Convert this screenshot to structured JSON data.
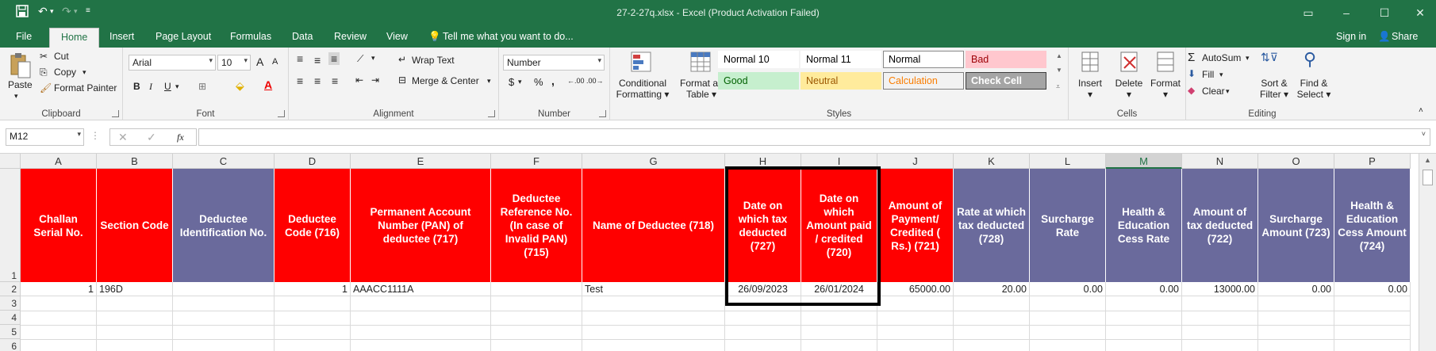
{
  "window": {
    "title": "27-2-27q.xlsx - Excel (Product Activation Failed)",
    "save_icon": "save-icon",
    "undo_icon": "undo-icon",
    "redo_icon": "redo-icon"
  },
  "tabs": [
    "File",
    "Home",
    "Insert",
    "Page Layout",
    "Formulas",
    "Data",
    "Review",
    "View"
  ],
  "tell_me": "Tell me what you want to do...",
  "sign_in": "Sign in",
  "share": "Share",
  "ribbon": {
    "clipboard": {
      "label": "Clipboard",
      "paste": "Paste",
      "cut": "Cut",
      "copy": "Copy",
      "format_painter": "Format Painter"
    },
    "font": {
      "label": "Font",
      "name": "Arial",
      "size": "10",
      "bold": "B",
      "italic": "I",
      "underline": "U",
      "grow": "A",
      "shrink": "A"
    },
    "alignment": {
      "label": "Alignment",
      "wrap": "Wrap Text",
      "merge": "Merge & Center"
    },
    "number": {
      "label": "Number",
      "format": "Number",
      "currency": "$",
      "percent": "%",
      "comma": ","
    },
    "styles": {
      "label": "Styles",
      "conditional": [
        "Conditional",
        "Formatting"
      ],
      "format_table": [
        "Format as",
        "Table"
      ],
      "cells": [
        {
          "text": "Normal 10",
          "bg": "#ffffff",
          "fg": "#000000",
          "border": "transparent"
        },
        {
          "text": "Normal 11",
          "bg": "#ffffff",
          "fg": "#000000",
          "border": "transparent"
        },
        {
          "text": "Normal",
          "bg": "#ffffff",
          "fg": "#000000",
          "border": "#8a8a8a"
        },
        {
          "text": "Bad",
          "bg": "#ffc7ce",
          "fg": "#9c0006",
          "border": "transparent"
        },
        {
          "text": "Good",
          "bg": "#c6efce",
          "fg": "#006100",
          "border": "transparent"
        },
        {
          "text": "Neutral",
          "bg": "#ffeb9c",
          "fg": "#9c5700",
          "border": "transparent"
        },
        {
          "text": "Calculation",
          "bg": "#f2f2f2",
          "fg": "#fa7d00",
          "border": "#7f7f7f"
        },
        {
          "text": "Check Cell",
          "bg": "#a5a5a5",
          "fg": "#ffffff",
          "border": "#3f3f3f"
        }
      ]
    },
    "cells": {
      "label": "Cells",
      "insert": "Insert",
      "delete": "Delete",
      "format": "Format"
    },
    "editing": {
      "label": "Editing",
      "autosum": "AutoSum",
      "fill": "Fill",
      "clear": "Clear",
      "sort": [
        "Sort &",
        "Filter"
      ],
      "find": [
        "Find &",
        "Select"
      ]
    }
  },
  "formula_bar": {
    "name_box": "M12",
    "fx": "fx",
    "formula": ""
  },
  "columns": [
    "A",
    "B",
    "C",
    "D",
    "E",
    "F",
    "G",
    "H",
    "I",
    "J",
    "K",
    "L",
    "M",
    "N",
    "O",
    "P"
  ],
  "selected_column": "M",
  "rows": [
    "1",
    "2",
    "3",
    "4",
    "5",
    "6"
  ],
  "header_row": [
    {
      "text": "Challan Serial No.",
      "color": "red"
    },
    {
      "text": "Section Code",
      "color": "red"
    },
    {
      "text": "Deductee Identification No.",
      "color": "purple"
    },
    {
      "text": "Deductee Code (716)",
      "color": "red"
    },
    {
      "text": "Permanent Account Number (PAN) of deductee (717)",
      "color": "red"
    },
    {
      "text": "Deductee Reference No. (In case of Invalid PAN) (715)",
      "color": "red"
    },
    {
      "text": "Name of Deductee (718)",
      "color": "red"
    },
    {
      "text": "Date on which tax deducted (727)",
      "color": "red"
    },
    {
      "text": "Date on which Amount paid / credited (720)",
      "color": "red"
    },
    {
      "text": "Amount of Payment/ Credited ( Rs.) (721)",
      "color": "red"
    },
    {
      "text": "Rate at which tax deducted (728)",
      "color": "purple"
    },
    {
      "text": "Surcharge Rate",
      "color": "purple"
    },
    {
      "text": "Health & Education Cess Rate",
      "color": "purple"
    },
    {
      "text": "Amount of tax deducted (722)",
      "color": "purple"
    },
    {
      "text": "Surcharge Amount (723)",
      "color": "purple"
    },
    {
      "text": "Health & Education Cess Amount (724)",
      "color": "purple"
    }
  ],
  "data_row": [
    {
      "text": "1",
      "align": "r"
    },
    {
      "text": "196D",
      "align": "l"
    },
    {
      "text": "",
      "align": "l"
    },
    {
      "text": "1",
      "align": "r"
    },
    {
      "text": "AAACC1111A",
      "align": "l"
    },
    {
      "text": "",
      "align": "l"
    },
    {
      "text": "Test",
      "align": "l"
    },
    {
      "text": "26/09/2023",
      "align": "c"
    },
    {
      "text": "26/01/2024",
      "align": "c"
    },
    {
      "text": "65000.00",
      "align": "r"
    },
    {
      "text": "20.00",
      "align": "r"
    },
    {
      "text": "0.00",
      "align": "r"
    },
    {
      "text": "0.00",
      "align": "r"
    },
    {
      "text": "13000.00",
      "align": "r"
    },
    {
      "text": "0.00",
      "align": "r"
    },
    {
      "text": "0.00",
      "align": "r"
    }
  ],
  "colors": {
    "brand": "#217346",
    "header_red": "#ff0000",
    "header_purple": "#6a6a9c"
  }
}
